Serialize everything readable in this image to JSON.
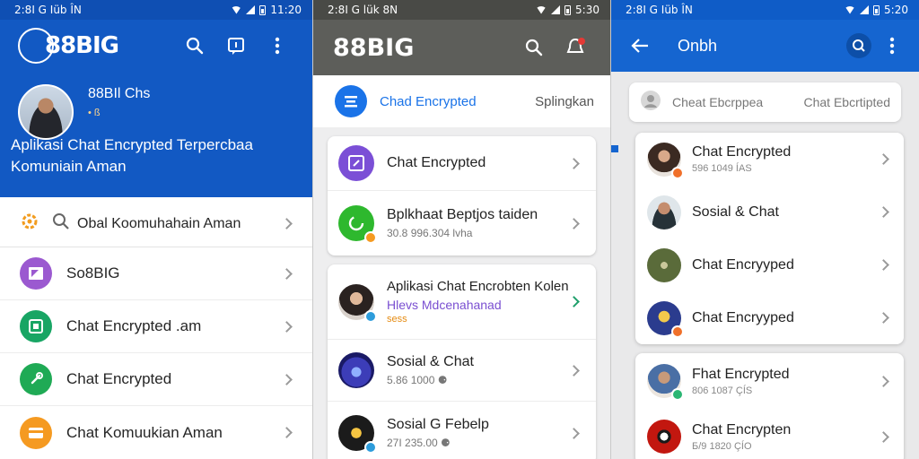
{
  "panel1": {
    "status": {
      "left": "2:8I G Iüb ÎN",
      "time": "11:20"
    },
    "logo": "88BIG",
    "profile": {
      "name": "88BIl Chs",
      "status": "• ß",
      "bio": "Aplikasi Chat Encrypted Terpercbaa Komuniain Aman"
    },
    "menu": [
      {
        "label": "Obal Koomuhahain Aman",
        "icon": "search-icon"
      },
      {
        "label": "So8BIG",
        "icon": "image-icon",
        "color": "#9b59d0"
      },
      {
        "label": "Chat Encrypted .am",
        "icon": "chat-icon",
        "color": "#18a564"
      },
      {
        "label": "Chat Encrypted",
        "icon": "link-icon",
        "color": "#1faa55"
      },
      {
        "label": "Chat Komuukian Aman",
        "icon": "card-icon",
        "color": "#f59a21"
      }
    ]
  },
  "panel2": {
    "status": {
      "left": "2:8I G lük 8N",
      "time": "5:30"
    },
    "logo": "88BIG",
    "tabs": {
      "active": "Chad Encrypted",
      "other": "Splingkan"
    },
    "card1": [
      {
        "title": "Chat Encrypted",
        "sub": "",
        "color": "#7b4fd6"
      },
      {
        "title": "Bplkhaat Beptjos taiden",
        "sub": "30.8 996.304 lvha",
        "color": "#2eb82e"
      }
    ],
    "card2": [
      {
        "title": "Aplikasi Chat Encrobten Kolen",
        "sub": "Hlevs Mdcenahanad",
        "sub2": "sess",
        "color": "#cfa68a"
      },
      {
        "title": "Sosial & Chat",
        "sub": "5.86 1000 ⚈",
        "color": "#3c3db8"
      },
      {
        "title": "Sosial G Febelp",
        "sub": "27I 235.00 ⚈",
        "color": "#1b1b1b"
      }
    ]
  },
  "panel3": {
    "status": {
      "left": "2:8I G Iüb ÎN",
      "time": "5:20"
    },
    "title": "Onbh",
    "search": {
      "placeholder1": "Cheat Ebcrppea",
      "placeholder2": "Chat Ebcrtipted"
    },
    "card1": [
      {
        "title": "Chat Encrypted",
        "sub": "596 1049 ÍAS",
        "color": "#6b3b2a"
      },
      {
        "title": "Sosial & Chat",
        "sub": "",
        "color": "#263238"
      },
      {
        "title": "Chat Encryyped",
        "sub": "",
        "color": "#5a6b3a"
      },
      {
        "title": "Chat Encryyped",
        "sub": "",
        "color": "#2b3c8e"
      }
    ],
    "card2": [
      {
        "title": "Fhat Encrypted",
        "sub": "806 1087 ÇÍS",
        "color": "#cdbfb1"
      },
      {
        "title": "Chat Encrypten",
        "sub": "Б/9 1820 ÇÍO",
        "color": "#c2170f"
      }
    ]
  },
  "colors": {
    "blue": "#1259c3",
    "grayBar": "#5d5e5a",
    "accent": "#1a73e8"
  }
}
